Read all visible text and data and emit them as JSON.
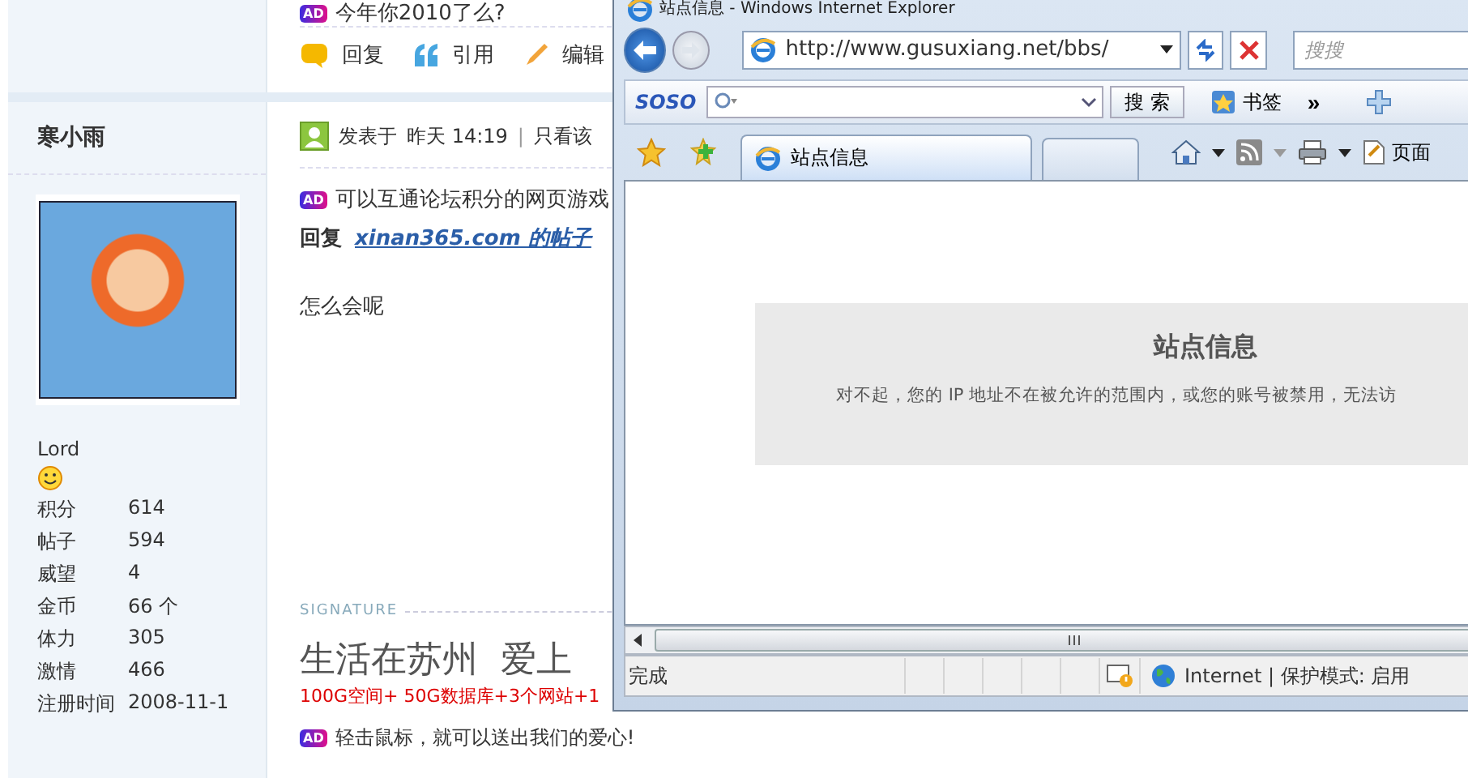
{
  "forum": {
    "top_post": {
      "ad": {
        "badge": "AD",
        "text": "今年你2010了么?"
      },
      "actions": [
        {
          "label": "回复",
          "kind": "reply"
        },
        {
          "label": "引用",
          "kind": "quote"
        },
        {
          "label": "编辑",
          "kind": "edit"
        }
      ]
    },
    "author": {
      "name": "寒小雨",
      "rank": "Lord",
      "stats": [
        {
          "label": "积分",
          "value": "614"
        },
        {
          "label": "帖子",
          "value": "594"
        },
        {
          "label": "威望",
          "value": "4"
        },
        {
          "label": "金币",
          "value": "66 个"
        },
        {
          "label": "体力",
          "value": "305"
        },
        {
          "label": "激情",
          "value": "466"
        },
        {
          "label": "注册时间",
          "value": "2008-11-1"
        }
      ]
    },
    "post": {
      "posted_label": "发表于",
      "time": "昨天 14:19",
      "separator": "|",
      "view_only": "只看该",
      "ad": {
        "badge": "AD",
        "text": "可以互通论坛积分的网页游戏"
      },
      "reply_prefix": "回复",
      "reply_link": "xinan365.com 的帖子",
      "body": "怎么会呢",
      "signature_label": "SIGNATURE",
      "signature_title": "生活在苏州  爱上",
      "signature_promo": "100G空间+ 50G数据库+3个网站+1",
      "bottom_ad": {
        "badge": "AD",
        "text": "轻击鼠标，就可以送出我们的爱心!"
      }
    }
  },
  "browser": {
    "title": "站点信息 - Windows Internet Explorer",
    "address": "http://www.gusuxiang.net/bbs/",
    "search_placeholder": "搜搜",
    "soso": {
      "logo": "SOSO",
      "button": "搜 索",
      "bookmarks": "书签",
      "more": "»"
    },
    "tabs": [
      {
        "label": "站点信息",
        "selected": true
      }
    ],
    "page_menu": "页面",
    "content": {
      "title": "站点信息",
      "message": "对不起，您的 IP 地址不在被允许的范围内，或您的账号被禁用，无法访"
    },
    "status": {
      "text": "完成",
      "zone": "Internet | 保护模式: 启用"
    }
  }
}
